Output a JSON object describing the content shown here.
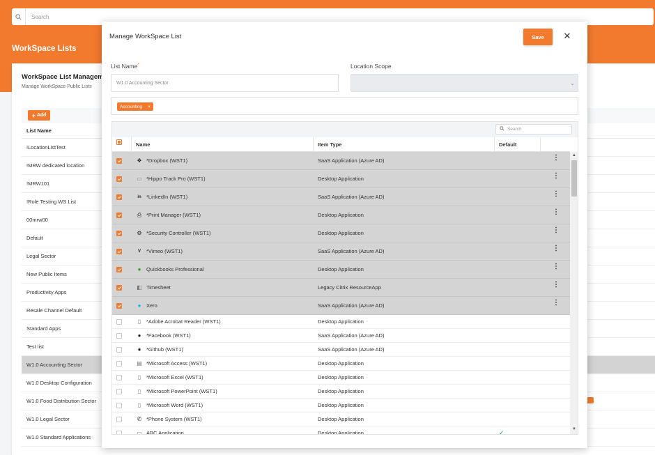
{
  "background": {
    "search_placeholder": "Search",
    "page_title": "WorkSpace Lists",
    "card_title": "WorkSpace List Managem",
    "card_subtitle": "Manage WorkSpace Public Lists",
    "add_label": "Add",
    "column_header": "List Name",
    "lists": [
      "!LocationListTest",
      "!MRW dedicated location",
      "!MRW101",
      "!Role Testing WS List",
      "00mrw00",
      "Default",
      "Legal Sector",
      "New Public Items",
      "Productivity Apps",
      "Resale Channel Default",
      "Standard Apps",
      "Test list",
      "W1.0 Accounting Sector",
      "W1.0 Desktop Configuration",
      "W1.0 Food Distribution Sector",
      "W1.0 Legal Sector",
      "W1.0 Standard Applications"
    ],
    "selected_index": 12
  },
  "modal": {
    "title": "Manage WorkSpace List",
    "save_label": "Save",
    "close_label": "✕",
    "list_name_label": "List Name",
    "required_mark": "*",
    "list_name_value": "W1.0 Accounting Sector",
    "location_scope_label": "Location Scope",
    "location_scope_value": "",
    "tags": [
      {
        "label": "Accounting",
        "remove": "×"
      }
    ],
    "grid": {
      "search_placeholder": "Search",
      "columns": {
        "name": "Name",
        "item_type": "Item Type",
        "default": "Default"
      },
      "rows": [
        {
          "name": "*Dropbox (WST1)",
          "type": "SaaS Application (Azure AD)",
          "icon": "dropbox-icon",
          "selected": true
        },
        {
          "name": "*Hippo Track Pro (WST1)",
          "type": "Desktop Application",
          "icon": "hippo-icon",
          "selected": true
        },
        {
          "name": "*LinkedIn (WST1)",
          "type": "SaaS Application (Azure AD)",
          "icon": "linkedin-icon",
          "selected": true
        },
        {
          "name": "*Print Manager (WST1)",
          "type": "Desktop Application",
          "icon": "printer-icon",
          "selected": true
        },
        {
          "name": "*Security Controller (WST1)",
          "type": "Desktop Application",
          "icon": "security-icon",
          "selected": true
        },
        {
          "name": "*Vimeo (WST1)",
          "type": "SaaS Application (Azure AD)",
          "icon": "vimeo-icon",
          "selected": true
        },
        {
          "name": "Quickbooks Professional",
          "type": "Desktop Application",
          "icon": "quickbooks-icon",
          "selected": true
        },
        {
          "name": "Timesheet",
          "type": "Legacy Citrix ResourceApp",
          "icon": "timesheet-icon",
          "selected": true
        },
        {
          "name": "Xero",
          "type": "SaaS Application (Azure AD)",
          "icon": "xero-icon",
          "selected": true
        },
        {
          "name": "*Adobe Acrobat Reader (WST1)",
          "type": "Desktop Application",
          "icon": "document-icon",
          "selected": false
        },
        {
          "name": "*Facebook (WST1)",
          "type": "SaaS Application (Azure AD)",
          "icon": "facebook-icon",
          "selected": false
        },
        {
          "name": "*Github (WST1)",
          "type": "SaaS Application (Azure AD)",
          "icon": "github-icon",
          "selected": false
        },
        {
          "name": "*Microsoft Access (WST1)",
          "type": "Desktop Application",
          "icon": "database-icon",
          "selected": false
        },
        {
          "name": "*Microsoft Excel (WST1)",
          "type": "Desktop Application",
          "icon": "document-icon",
          "selected": false
        },
        {
          "name": "*Microsoft PowerPoint (WST1)",
          "type": "Desktop Application",
          "icon": "document-icon",
          "selected": false
        },
        {
          "name": "*Microsoft Word (WST1)",
          "type": "Desktop Application",
          "icon": "document-icon",
          "selected": false
        },
        {
          "name": "*Phone System (WST1)",
          "type": "Desktop Application",
          "icon": "phone-icon",
          "selected": false
        },
        {
          "name": "ABC Application",
          "type": "Desktop Application",
          "icon": "app-icon",
          "selected": false,
          "default": true
        }
      ]
    }
  },
  "colors": {
    "accent": "#f27a2e",
    "selected_row": "#d4d4d4"
  }
}
